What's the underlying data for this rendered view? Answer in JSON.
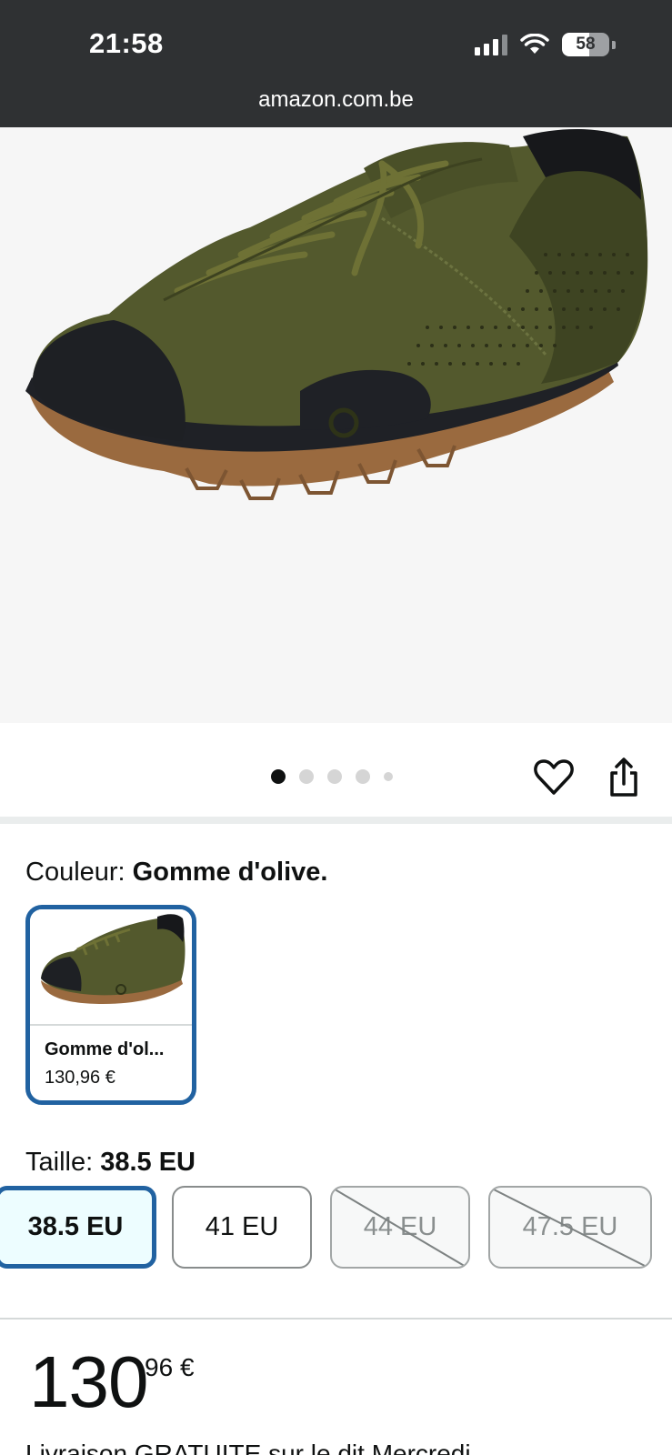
{
  "status_bar": {
    "time": "21:58",
    "battery_percent": "58",
    "battery_level": 0.58
  },
  "browser": {
    "url": "amazon.com.be"
  },
  "product_image": {
    "carousel_total": 5,
    "carousel_active_index": 0
  },
  "actions": {
    "wishlist_icon": "heart-icon",
    "share_icon": "share-icon"
  },
  "color": {
    "label": "Couleur: ",
    "selected": "Gomme d'olive.",
    "options": [
      {
        "name": "Gomme d'ol...",
        "price": "130,96 €"
      }
    ]
  },
  "size": {
    "label": "Taille: ",
    "selected": "38.5 EU",
    "options": [
      {
        "label": "38.5 EU",
        "state": "selected"
      },
      {
        "label": "41 EU",
        "state": "available"
      },
      {
        "label": "44 EU",
        "state": "unavailable"
      },
      {
        "label": "47.5 EU",
        "state": "unavailable"
      }
    ]
  },
  "price": {
    "whole": "130",
    "fraction": "96",
    "currency": "€"
  },
  "delivery_text": "Livraison GRATUITE sur le dit Mercredi"
}
